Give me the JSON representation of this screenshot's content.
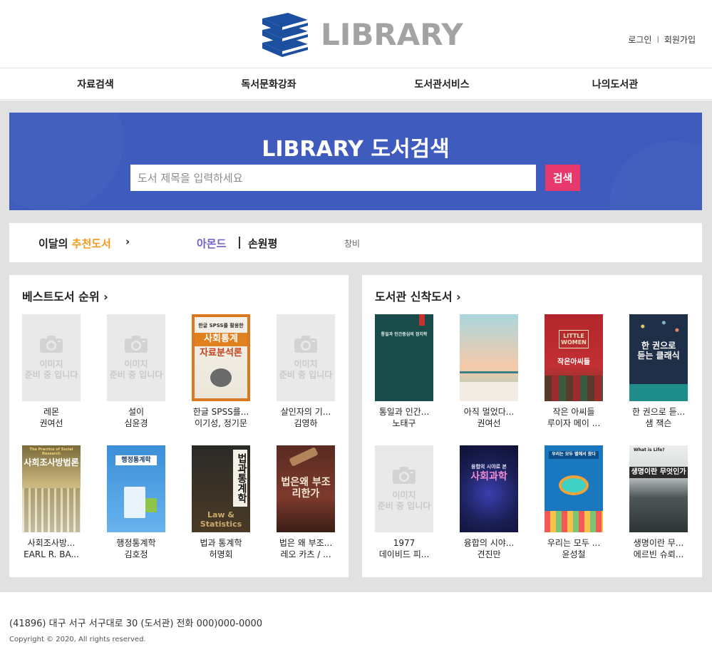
{
  "header": {
    "logo_text": "LIBRARY",
    "login": "로그인",
    "separator": "|",
    "signup": "회원가입"
  },
  "nav": {
    "items": [
      "자료검색",
      "독서문화강좌",
      "도서관서비스",
      "나의도서관"
    ]
  },
  "hero": {
    "title": "LIBRARY 도서검색",
    "search_placeholder": "도서 제목을 입력하세요",
    "search_button": "검색"
  },
  "recommend": {
    "label_prefix": "이달의",
    "label_accent": "추천도서",
    "chevron": "›",
    "title": "아몬드",
    "author": "손원평",
    "publisher": "창비"
  },
  "bestsellers": {
    "heading": "베스트도서 순위 ›",
    "books": [
      {
        "title": "레몬",
        "author": "권여선",
        "cover": "none"
      },
      {
        "title": "설이",
        "author": "심윤경",
        "cover": "none"
      },
      {
        "title": "한글 SPSS를...",
        "author": "이기성, 정기문",
        "cover": "spss"
      },
      {
        "title": "살인자의 기...",
        "author": "김영하",
        "cover": "none"
      },
      {
        "title": "사회조사방...",
        "author": "EARL R. BA...",
        "cover": "social"
      },
      {
        "title": "행정통계학",
        "author": "김호정",
        "cover": "admin"
      },
      {
        "title": "법과 통계학",
        "author": "허명회",
        "cover": "law"
      },
      {
        "title": "법은 왜 부조...",
        "author": "레오 카츠 / ...",
        "cover": "lawwhy"
      }
    ]
  },
  "new_arrivals": {
    "heading": "도서관 신착도서 ›",
    "books": [
      {
        "title": "통일과 인간...",
        "author": "노태구",
        "cover": "unify"
      },
      {
        "title": "아직 멀었다...",
        "author": "권여선",
        "cover": "sky"
      },
      {
        "title": "작은 아씨들",
        "author": "루이자 메이 ...",
        "cover": "women"
      },
      {
        "title": "한 권으로 듣...",
        "author": "샘 잭슨",
        "cover": "classic"
      },
      {
        "title": "1977",
        "author": "데이비드 피...",
        "cover": "none"
      },
      {
        "title": "융합의 시야...",
        "author": "견진만",
        "cover": "science"
      },
      {
        "title": "우리는 모두 ...",
        "author": "윤성철",
        "cover": "planet"
      },
      {
        "title": "생명이란 무...",
        "author": "에르빈 슈뢰...",
        "cover": "life"
      }
    ]
  },
  "no_image_text": [
    "이미지",
    "준비 중 입니다"
  ],
  "cover_texts": {
    "spss_top": "한글 SPSS를 활용한",
    "spss_main": "사회통계",
    "spss_sub": "자료분석론",
    "social_top": "The Practice of Social Research",
    "social_main": "사회조사방법론",
    "admin_main": "행정통계학",
    "law_main": "법과통계학",
    "law_en": "Law & Statistics",
    "lawwhy_main": "법은왜 부조리한가",
    "unify_main": "통일과 인간중심의 정치학",
    "women_main": "LITTLE WOMEN",
    "women_kr": "작은아씨들",
    "classic_main": "한 권으로 듣는 클래식",
    "science_top": "융합의 시야로 본",
    "science_main": "사회과학",
    "planet_top": "우리는 모두 별에서 왔다",
    "life_top": "What is Life?",
    "life_main": "생명이란 무엇인가"
  },
  "footer": {
    "address": "(41896) 대구 서구 서구대로 30 (도서관) 전화 000)000-0000",
    "copyright": "Copyright © 2020, All rights reserved."
  },
  "colors": {
    "hero_bg": "#3e5bbd",
    "search_button": "#e8396c",
    "accent_orange": "#f39a1e",
    "accent_purple": "#6f5fc6",
    "logo_blue": "#1d4fa0",
    "logo_text": "#a3a3a3",
    "page_gray": "#e1e1e1"
  },
  "icons": [
    "books-logo-icon",
    "camera-icon",
    "chevron-right-icon"
  ]
}
